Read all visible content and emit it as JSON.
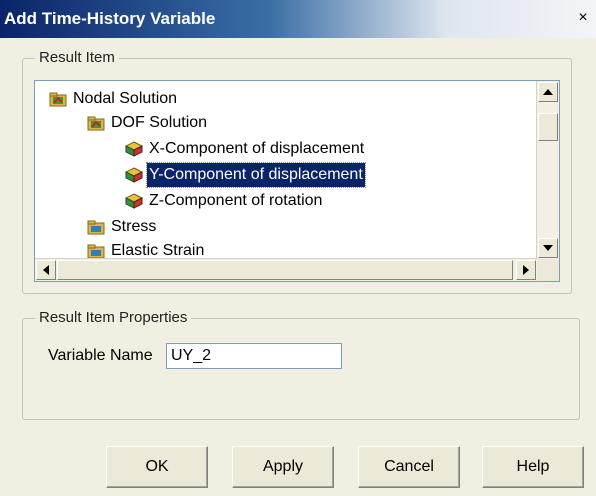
{
  "window": {
    "title": "Add Time-History Variable",
    "close_glyph": "×"
  },
  "result_item": {
    "group_label": "Result Item",
    "tree": [
      {
        "label": "Nodal Solution",
        "icon": "folder-results-icon"
      },
      {
        "label": "DOF Solution",
        "icon": "folder-results-icon"
      },
      {
        "label": "X-Component of displacement",
        "icon": "cube-icon"
      },
      {
        "label": "Y-Component of displacement",
        "icon": "cube-icon",
        "selected": true
      },
      {
        "label": "Z-Component of rotation",
        "icon": "cube-icon"
      },
      {
        "label": "Stress",
        "icon": "folder-icon"
      },
      {
        "label": "Elastic Strain",
        "icon": "folder-icon"
      }
    ]
  },
  "properties": {
    "group_label": "Result Item Properties",
    "variable_name_label": "Variable Name",
    "variable_name_value": "UY_2"
  },
  "buttons": {
    "ok": "OK",
    "apply": "Apply",
    "cancel": "Cancel",
    "help": "Help"
  }
}
